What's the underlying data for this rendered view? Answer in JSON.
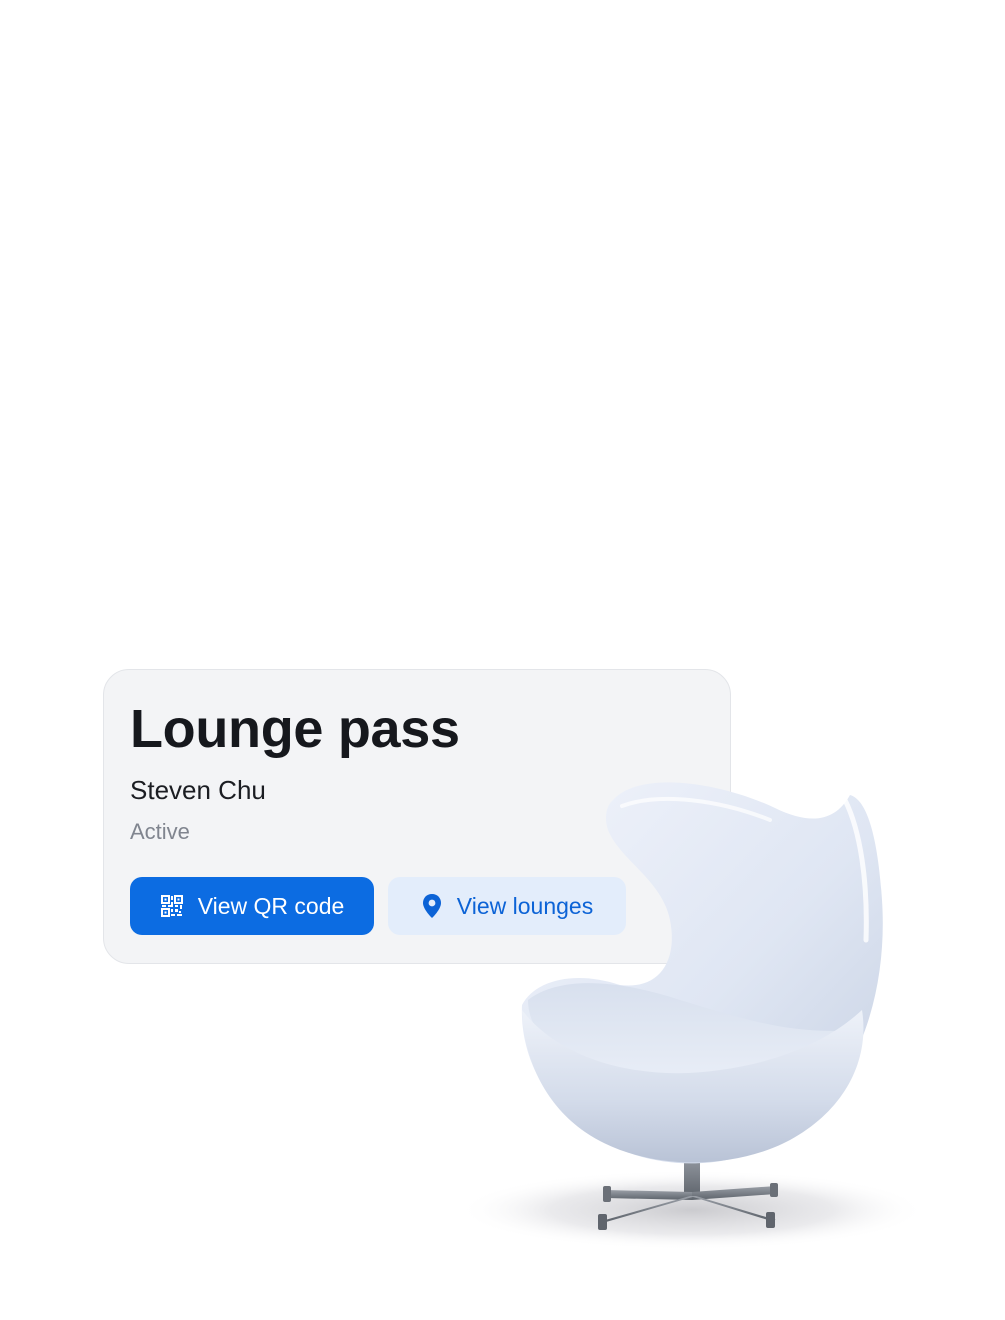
{
  "card": {
    "title": "Lounge pass",
    "holder_name": "Steven Chu",
    "status": "Active",
    "primary_button": {
      "label": "View QR code",
      "icon": "qr-code-icon"
    },
    "secondary_button": {
      "label": "View lounges",
      "icon": "location-pin-icon"
    }
  },
  "illustration": {
    "subject": "egg-chair-illustration"
  },
  "colors": {
    "accent": "#0c6ce2",
    "secondary_button_bg": "#e3edfb",
    "card_bg": "#f3f4f6",
    "status_text": "#80858f"
  }
}
